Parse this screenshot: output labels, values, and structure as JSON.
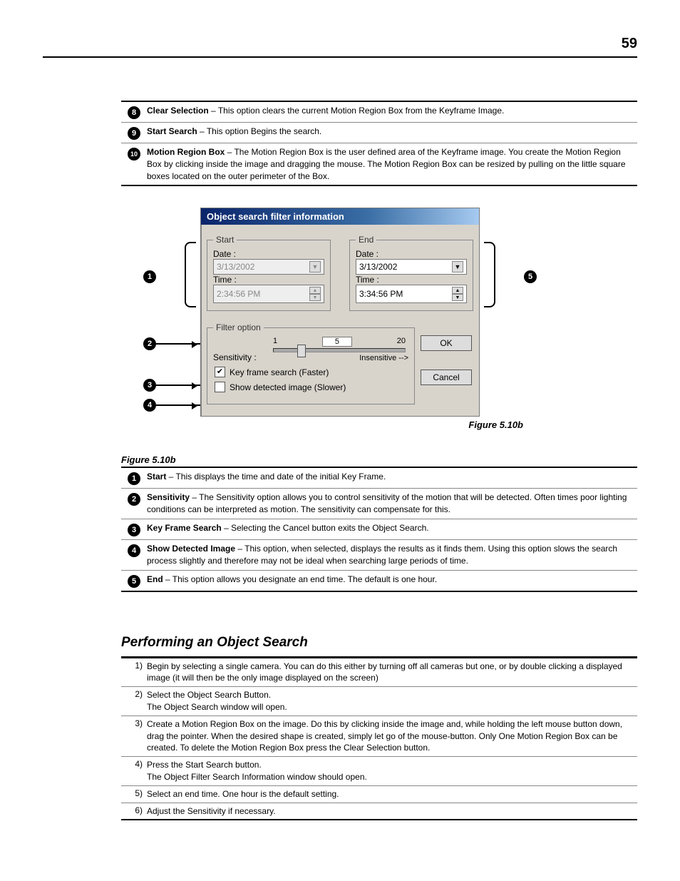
{
  "pageNumber": "59",
  "topDefs": [
    {
      "num": "8",
      "label": "Clear Selection",
      "text": " – This option clears the current Motion Region Box from the Keyframe Image."
    },
    {
      "num": "9",
      "label": "Start Search",
      "text": " – This option Begins the search."
    },
    {
      "num": "10",
      "label": "Motion Region Box",
      "text": " – The Motion Region Box is the user defined area of the Keyframe image. You create the Motion Region Box by clicking inside the image and dragging the mouse. The Motion Region Box can be resized by pulling on the little square boxes located on the outer perimeter of the Box."
    }
  ],
  "dialog": {
    "title": "Object search filter information",
    "start": {
      "legend": "Start",
      "dateLabel": "Date :",
      "dateValue": "3/13/2002",
      "timeLabel": "Time :",
      "timeValue": "2:34:56 PM"
    },
    "end": {
      "legend": "End",
      "dateLabel": "Date :",
      "dateValue": "3/13/2002",
      "timeLabel": "Time :",
      "timeValue": "3:34:56 PM"
    },
    "filter": {
      "legend": "Filter option",
      "sensitivityLabel": "Sensitivity :",
      "scaleLow": "1",
      "scaleMid": "5",
      "scaleHigh": "20",
      "insensitive": "Insensitive -->",
      "keyframe": "Key frame search (Faster)",
      "showDetected": "Show detected image (Slower)"
    },
    "ok": "OK",
    "cancel": "Cancel"
  },
  "figureLabelTop": "Figure 5.10b",
  "figureLabelBottom": "Figure 5.10b",
  "bottomDefs": [
    {
      "num": "1",
      "label": "Start",
      "text": " – This displays the time and date of the initial Key Frame."
    },
    {
      "num": "2",
      "label": "Sensitivity",
      "text": " – The Sensitivity option allows you to control sensitivity of the motion that will be detected. Often times poor lighting conditions can be interpreted as motion. The sensitivity can compensate for this."
    },
    {
      "num": "3",
      "label": "Key Frame Search",
      "text": " – Selecting the Cancel button exits the Object Search."
    },
    {
      "num": "4",
      "label": "Show Detected Image",
      "text": " – This option, when selected, displays the results as it finds them. Using this option slows the search process slightly and therefore may not be ideal when searching large periods of time."
    },
    {
      "num": "5",
      "label": "End",
      "text": " – This option allows you designate an end time. The default is one hour."
    }
  ],
  "sectionTitle": "Performing an Object Search",
  "steps": [
    {
      "n": "1)",
      "t": "Begin by selecting a single camera. You can do this either by turning off all cameras but one, or by double clicking a displayed image (it will then be the only image displayed on the screen)"
    },
    {
      "n": "2)",
      "t": "Select the Object Search Button.\nThe Object Search window will open."
    },
    {
      "n": "3)",
      "t": "Create a Motion Region Box on the image. Do this by clicking inside the image and, while holding the left mouse button down, drag the pointer. When the desired shape is created, simply let go of the mouse-button. Only One Motion Region Box can be created. To delete the Motion Region Box press the Clear Selection button."
    },
    {
      "n": "4)",
      "t": "Press the Start Search button.\nThe Object Filter Search Information window should open."
    },
    {
      "n": "5)",
      "t": "Select an end time. One hour is the default setting."
    },
    {
      "n": "6)",
      "t": "Adjust the Sensitivity if necessary."
    }
  ],
  "callouts": {
    "c1": "1",
    "c2": "2",
    "c3": "3",
    "c4": "4",
    "c5": "5"
  }
}
